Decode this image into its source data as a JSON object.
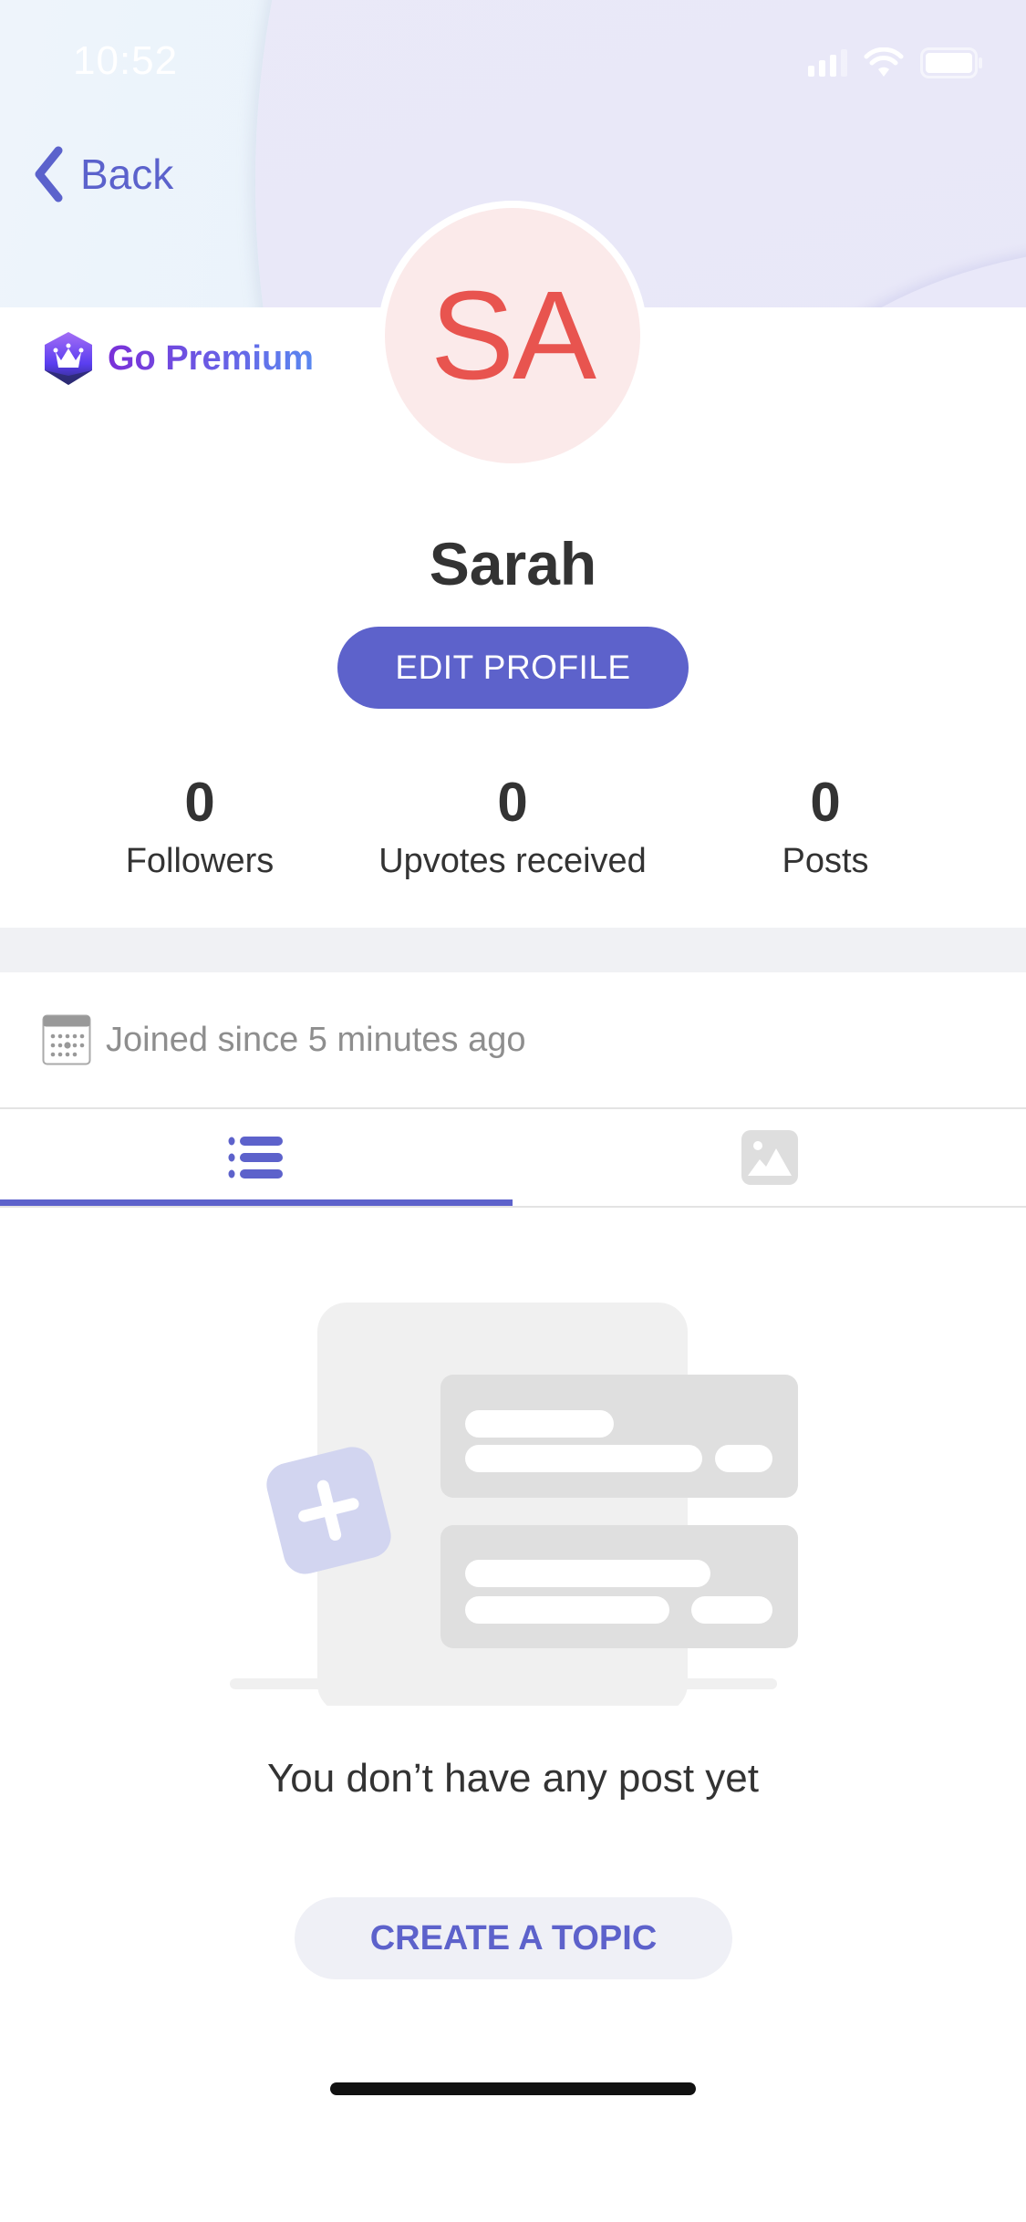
{
  "status_bar": {
    "time": "10:52",
    "icons": [
      "signal-icon",
      "wifi-icon",
      "battery-icon"
    ]
  },
  "nav": {
    "back_label": "Back",
    "back_icon": "chevron-left-icon"
  },
  "premium": {
    "label": "Go Premium",
    "icon": "crown-gem-icon"
  },
  "profile": {
    "initials": "SA",
    "name": "Sarah",
    "edit_button": "EDIT PROFILE",
    "avatar_bg": "#fbeaea",
    "avatar_color": "#e8544f"
  },
  "stats": [
    {
      "value": "0",
      "label": "Followers"
    },
    {
      "value": "0",
      "label": "Upvotes received"
    },
    {
      "value": "0",
      "label": "Posts"
    }
  ],
  "joined": {
    "text": "Joined since 5 minutes ago",
    "icon": "calendar-icon"
  },
  "tabs": [
    {
      "name": "posts-list",
      "icon": "list-icon",
      "active": true
    },
    {
      "name": "media",
      "icon": "image-icon",
      "active": false
    }
  ],
  "empty_state": {
    "message": "You don’t have any post yet",
    "button": "CREATE A TOPIC"
  },
  "colors": {
    "accent": "#5d62cb",
    "text": "#333333",
    "muted": "#8e8e8e",
    "band": "#f0f1f4"
  }
}
